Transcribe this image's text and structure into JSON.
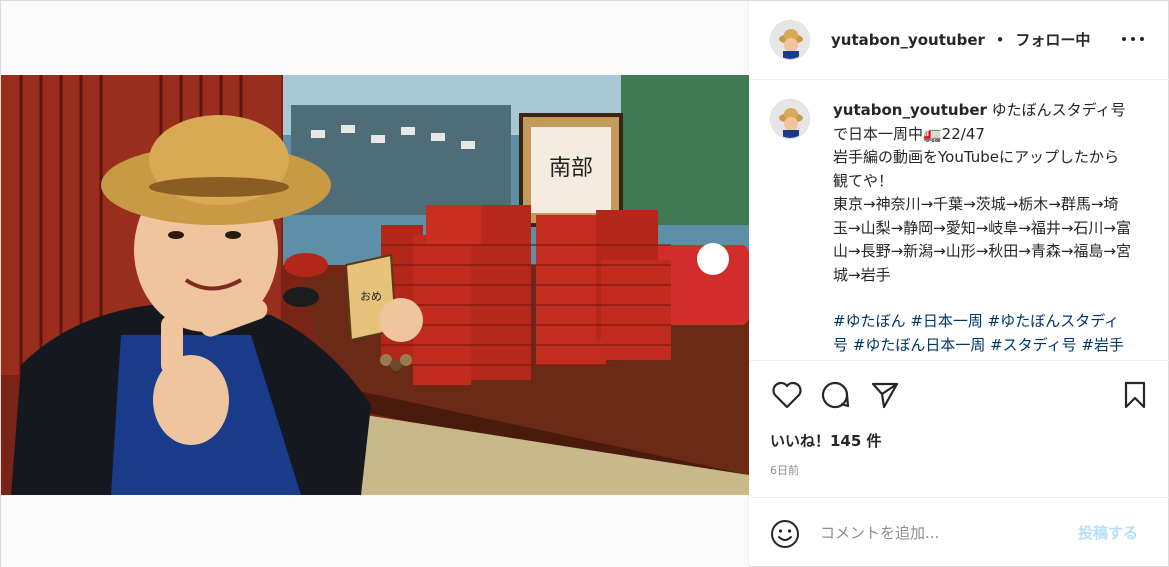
{
  "post": {
    "username": "yutabon_youtuber",
    "follow_status": "フォロー中",
    "separator": "•",
    "photo_label": "Post photo: boy in straw hat giving thumbs up beside stacks of red wanko soba bowls",
    "caption": {
      "username": "yutabon_youtuber",
      "line1": "ゆたぼんスタディ号で日本一周中🚛22/47",
      "line2": "岩手編の動画をYouTubeにアップしたから観てや！",
      "route": "東京→神奈川→千葉→茨城→栃木→群馬→埼玉→山梨→静岡→愛知→岐阜→福井→石川→富山→長野→新潟→山形→秋田→青森→福島→宮城→岩手",
      "hashtags": "#ゆたぼん #日本一周 #ゆたぼんスタディ号 #ゆたぼん日本一周 #スタディ号 #岩手 #ゆたぼんチャンネル"
    },
    "likes_text": "いいね！145 件",
    "time_text": "6日前",
    "comment_placeholder": "コメントを追加...",
    "post_button": "投稿する"
  },
  "icons": {
    "more": "more-horizontal-icon",
    "like": "heart-icon",
    "comment": "comment-icon",
    "share": "paper-plane-icon",
    "save": "bookmark-icon",
    "emoji": "smiley-icon"
  },
  "colors": {
    "link": "#00376b",
    "post_button_disabled": "#b2dffc",
    "muted": "#8e8e8e"
  }
}
